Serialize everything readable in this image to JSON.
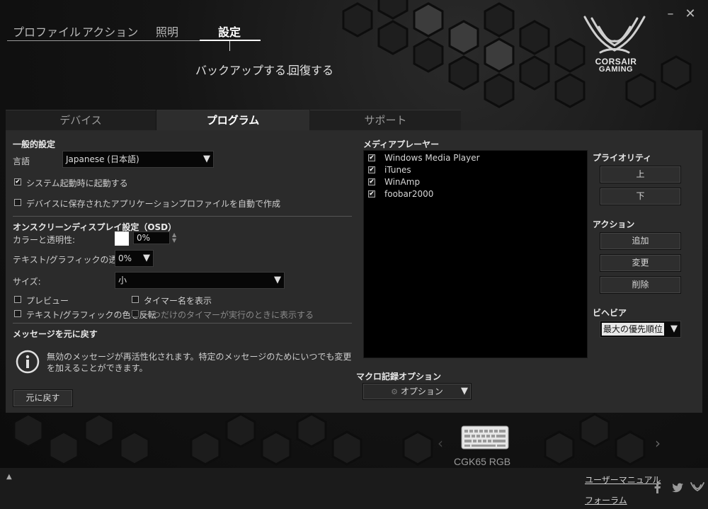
{
  "window": {
    "minimize": "–",
    "close": "✕"
  },
  "nav": {
    "tabs": [
      "プロファイル",
      "アクション",
      "照明",
      "設定"
    ],
    "active": "設定",
    "backup": "バックアップする...",
    "restore": "回復する"
  },
  "logo": {
    "line1": "CORSAIR",
    "line2": "GAMING"
  },
  "subtabs": {
    "device": "デバイス",
    "program": "プログラム",
    "support": "サポート"
  },
  "general": {
    "title": "一般的設定",
    "language_label": "言語",
    "language_value": "Japanese (日本語)",
    "startup_label": "システム起動時に起動する",
    "startup_checked": true,
    "autoprofile_label": "デバイスに保存されたアプリケーションプロファイルを自動で作成",
    "autoprofile_checked": false
  },
  "osd": {
    "title": "オンスクリーンディスプレイ設定（OSD）",
    "color_label": "カラーと透明性:",
    "color_swatch": "#ffffff",
    "color_opacity": "0%",
    "text_opacity_label": "テキスト/グラフィックの透明度:",
    "text_opacity_value": "0%",
    "size_label": "サイズ:",
    "size_value": "小",
    "preview_label": "プレビュー",
    "timer_name_label": "タイマー名を表示",
    "invert_label": "テキスト/グラフィックの色を反転",
    "single_timer_label": "一つだけのタイマーが実行のときに表示する"
  },
  "messages": {
    "title": "メッセージを元に戻す",
    "info_text": "無効のメッセージが再活性化されます。特定のメッセージのためにいつでも変更を加えることができます。",
    "revert_button": "元に戻す"
  },
  "media": {
    "title": "メディアプレーヤー",
    "players": [
      {
        "name": "Windows Media Player",
        "checked": true
      },
      {
        "name": "iTunes",
        "checked": true
      },
      {
        "name": "WinAmp",
        "checked": true
      },
      {
        "name": "foobar2000",
        "checked": true
      }
    ]
  },
  "priority": {
    "title": "プライオリティ",
    "up": "上",
    "down": "下"
  },
  "actions": {
    "title": "アクション",
    "add": "追加",
    "edit": "変更",
    "delete": "削除"
  },
  "behavior": {
    "title": "ビヘビア",
    "value": "最大の優先順位"
  },
  "macro": {
    "title": "マクロ記録オプション",
    "options_button": "オプション"
  },
  "device": {
    "name": "CGK65 RGB"
  },
  "footer": {
    "manual": "ユーザーマニュアル",
    "forum": "フォーラム",
    "collapse": "▲"
  },
  "colors": {
    "panel": "#2b2b2b",
    "accent": "#ffffff"
  }
}
